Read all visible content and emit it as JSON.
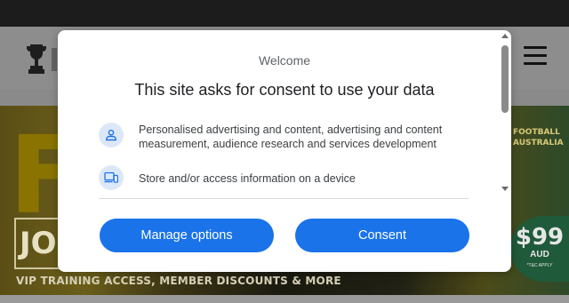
{
  "background": {
    "hero": {
      "big_letter": "F",
      "join_text": "JOI",
      "tagline": "VIP TRAINING ACCESS, MEMBER DISCOUNTS & MORE",
      "brand_text": "FOOTBALL AUSTRALIA",
      "price": "$99",
      "currency": "AUD",
      "terms": "*T&C APPLY"
    }
  },
  "dialog": {
    "welcome": "Welcome",
    "title": "This site asks for consent to use your data",
    "purposes": [
      {
        "icon": "person-icon",
        "text": "Personalised advertising and content, advertising and content measurement, audience research and services development"
      },
      {
        "icon": "devices-icon",
        "text": "Store and/or access information on a device"
      }
    ],
    "buttons": {
      "manage": "Manage options",
      "consent": "Consent"
    }
  },
  "colors": {
    "accent": "#1a73e8",
    "icon_bg": "#dce8f7"
  }
}
